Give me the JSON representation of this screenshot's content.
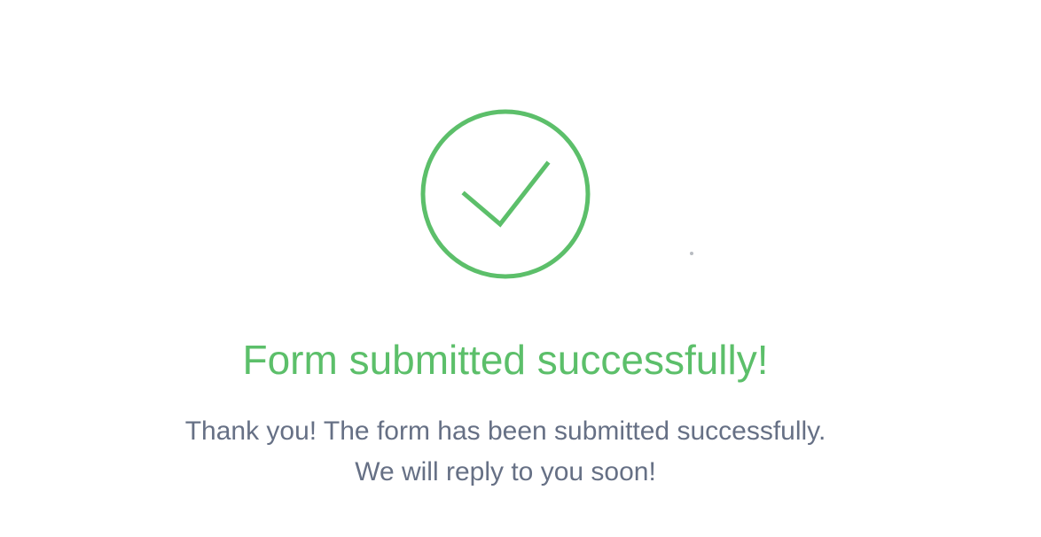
{
  "success": {
    "icon": "check-circle-icon",
    "title": "Form submitted successfully!",
    "message_line1": "Thank you! The form has been submitted successfully.",
    "message_line2": "We will reply to you soon!"
  },
  "colors": {
    "success": "#5cbf6a",
    "text_muted": "#667085",
    "background": "#ffffff"
  }
}
